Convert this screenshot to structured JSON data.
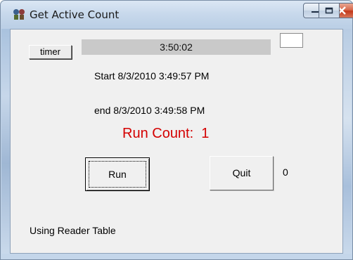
{
  "window": {
    "title": "Get Active Count",
    "icon": "app-icon"
  },
  "controls": {
    "timer_label": "timer",
    "time_display": "3:50:02",
    "start_text": "Start 8/3/2010 3:49:57 PM",
    "end_text": "end 8/3/2010 3:49:58 PM",
    "run_count_text": "Run Count:  1",
    "run_label": "Run",
    "quit_label": "Quit",
    "side_value": "0",
    "status_text": "Using Reader Table"
  },
  "colors": {
    "run_count": "#d40000",
    "close_button": "#c2381a"
  }
}
